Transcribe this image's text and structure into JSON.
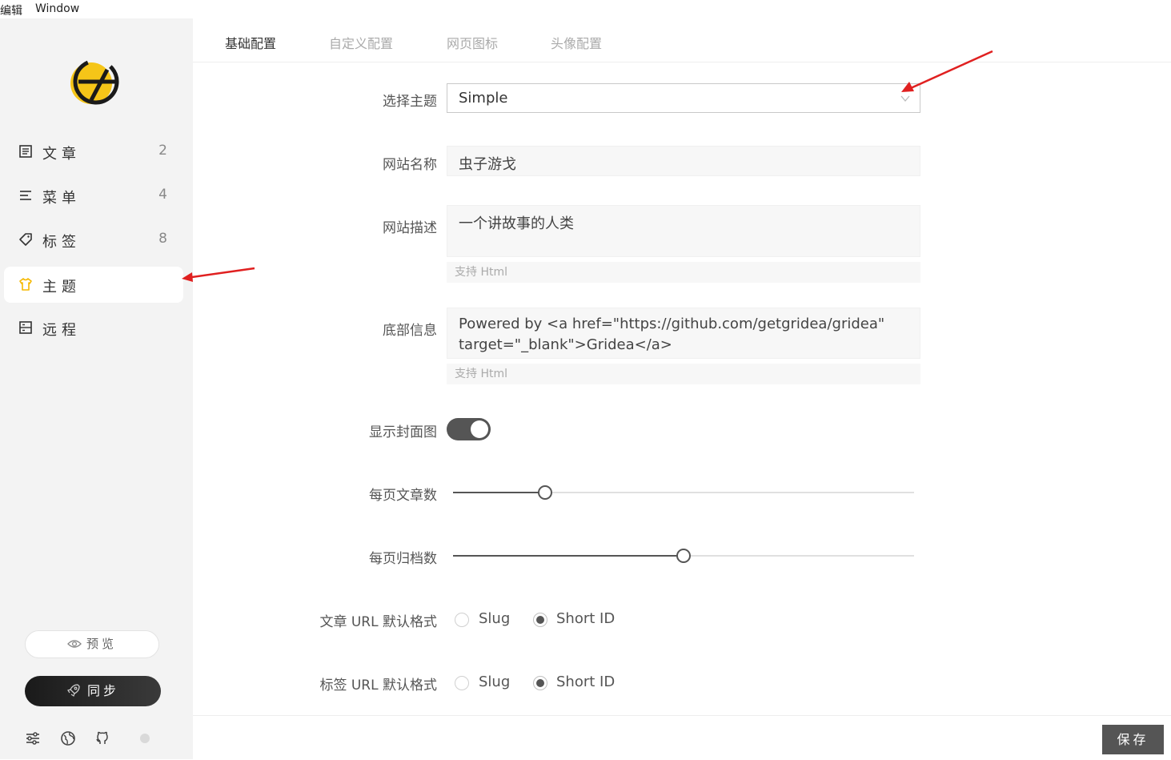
{
  "menubar": {
    "edit": "编辑",
    "window": "Window"
  },
  "sidebar": {
    "items": [
      {
        "label": "文章",
        "count": "2",
        "icon": "article-icon"
      },
      {
        "label": "菜单",
        "count": "4",
        "icon": "menu-icon"
      },
      {
        "label": "标签",
        "count": "8",
        "icon": "tag-icon"
      },
      {
        "label": "主题",
        "count": "",
        "icon": "shirt-icon",
        "active": true
      },
      {
        "label": "远程",
        "count": "",
        "icon": "remote-icon"
      }
    ],
    "preview_label": "预览",
    "sync_label": "同步"
  },
  "tabs": [
    {
      "label": "基础配置",
      "active": true
    },
    {
      "label": "自定义配置"
    },
    {
      "label": "网页图标"
    },
    {
      "label": "头像配置"
    }
  ],
  "form": {
    "theme": {
      "label": "选择主题",
      "value": "Simple"
    },
    "site_name": {
      "label": "网站名称",
      "value": "虫子游戈"
    },
    "site_desc": {
      "label": "网站描述",
      "value": "一个讲故事的人类",
      "hint": "支持 Html"
    },
    "footer_info": {
      "label": "底部信息",
      "line1": "Powered by <a href=\"https://github.com/getgridea/gridea\"",
      "line2": "target=\"_blank\">Gridea</a>",
      "hint": "支持 Html"
    },
    "show_cover": {
      "label": "显示封面图",
      "on": true
    },
    "posts_per_page": {
      "label": "每页文章数",
      "fraction": 0.2
    },
    "archives_per_page": {
      "label": "每页归档数",
      "fraction": 0.5
    },
    "post_url": {
      "label": "文章 URL 默认格式",
      "opt1": "Slug",
      "opt2": "Short ID",
      "selected": "Short ID"
    },
    "tag_url": {
      "label": "标签 URL 默认格式",
      "opt1": "Slug",
      "opt2": "Short ID",
      "selected": "Short ID"
    }
  },
  "save_label": "保存",
  "colors": {
    "accent": "#555555",
    "arrow": "#e02020",
    "logo_yellow": "#f5c518"
  }
}
